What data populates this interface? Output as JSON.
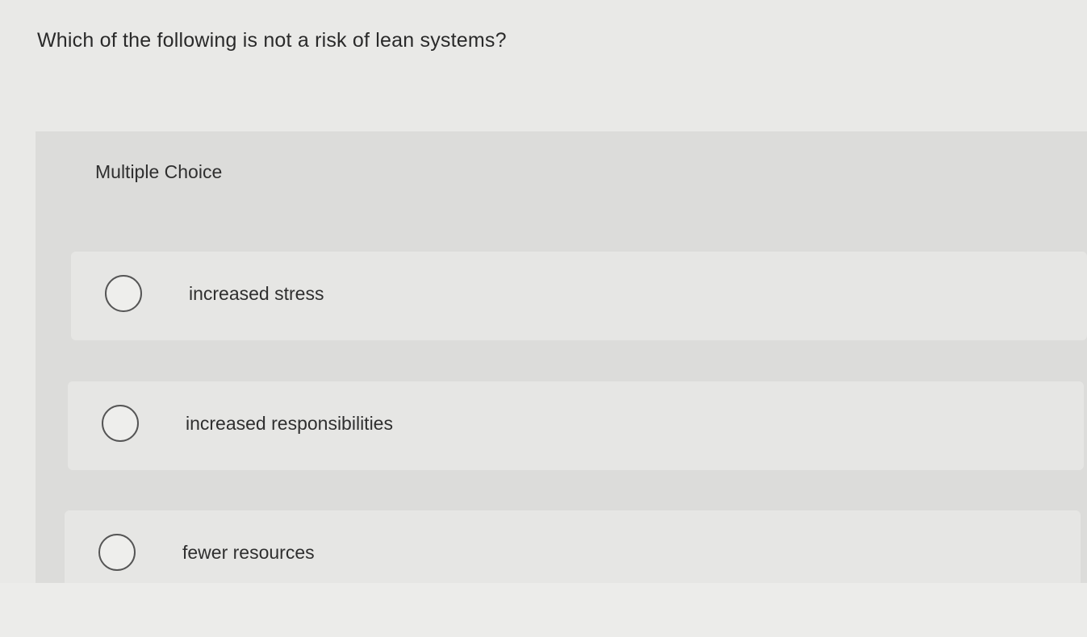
{
  "question": {
    "text": "Which of the following is not a risk of lean systems?"
  },
  "panel": {
    "label": "Multiple Choice"
  },
  "options": [
    {
      "label": "increased stress",
      "selected": false
    },
    {
      "label": "increased responsibilities",
      "selected": false
    },
    {
      "label": "fewer resources",
      "selected": false
    }
  ]
}
